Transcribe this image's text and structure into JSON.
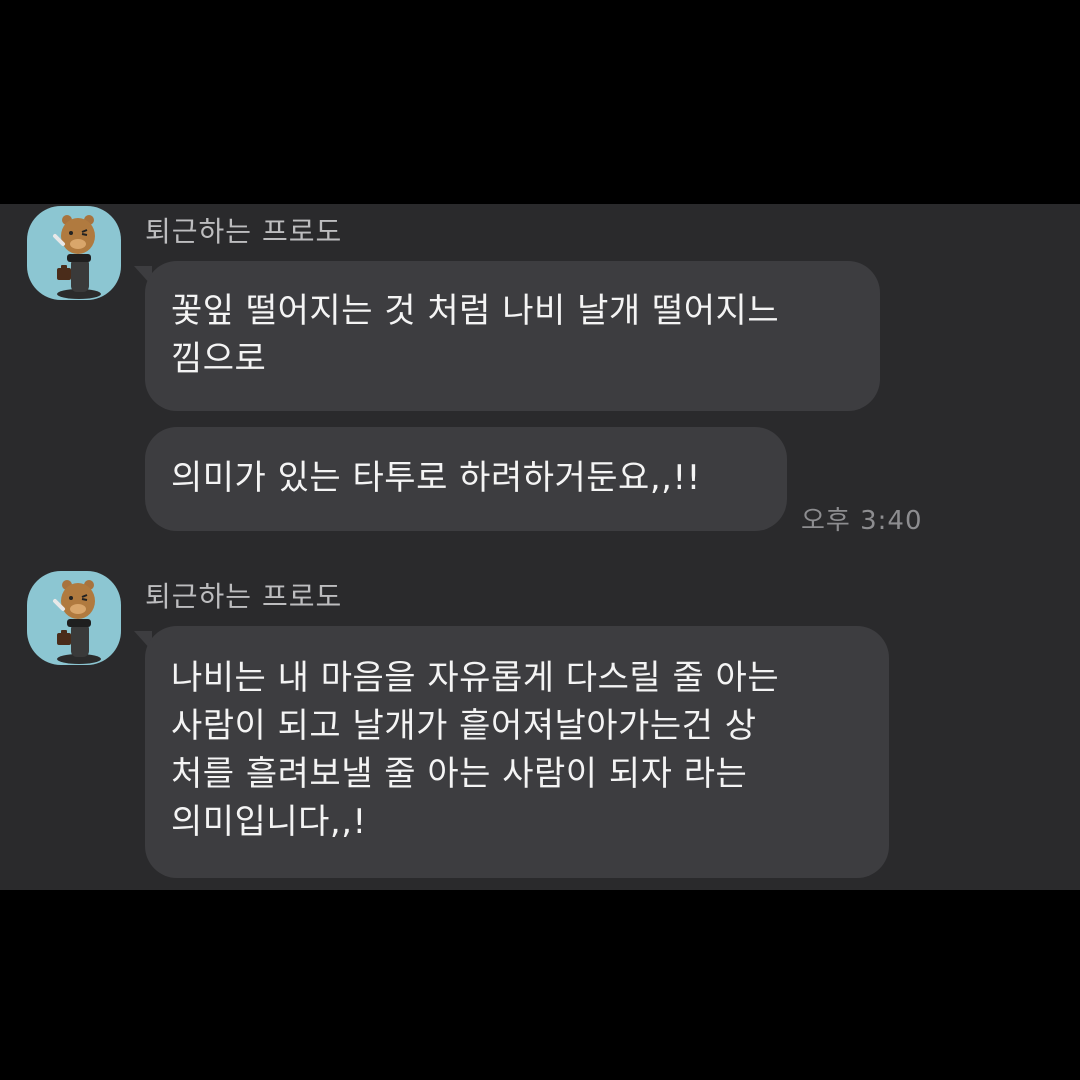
{
  "chat": {
    "messages": [
      {
        "sender": "퇴근하는 프로도",
        "avatar_icon": "frodo-character-icon",
        "bubbles": [
          {
            "lines": [
              "꽃잎 떨어지는 것 처럼 나비 날개 떨어지느",
              "낌으로"
            ]
          },
          {
            "lines": [
              "의미가 있는 타투로 하려하거둔요,,!!"
            ]
          }
        ],
        "time": "오후 3:40"
      },
      {
        "sender": "퇴근하는 프로도",
        "avatar_icon": "frodo-character-icon",
        "bubbles": [
          {
            "lines": [
              "나비는 내 마음을 자유롭게 다스릴 줄 아는",
              "사람이 되고 날개가 흩어져날아가는건 상",
              "처를 흘려보낼 줄 아는 사람이 되자 라는",
              "의미입니다,,!"
            ]
          }
        ]
      }
    ]
  },
  "colors": {
    "background": "#2a2a2c",
    "bubble": "#3d3d40",
    "bubble_text": "#f4f4f4",
    "sender_name": "#bdbdbf",
    "timestamp": "#8d8d90",
    "avatar_bg": "#8cc6d2"
  }
}
